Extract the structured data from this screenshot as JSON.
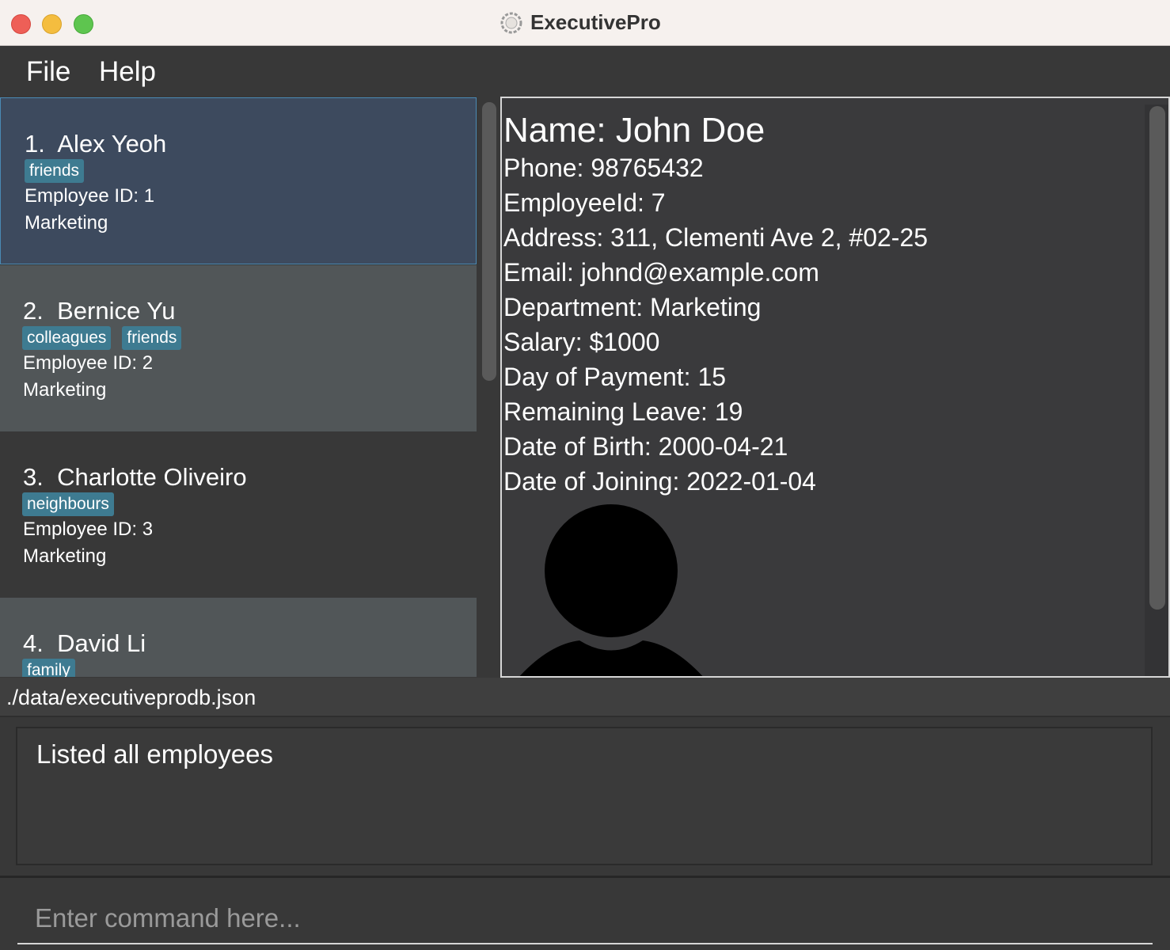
{
  "window": {
    "title": "ExecutivePro"
  },
  "menu": {
    "items": [
      {
        "label": "File"
      },
      {
        "label": "Help"
      }
    ]
  },
  "employees": [
    {
      "index": "1.",
      "name": "Alex Yeoh",
      "tags": [
        "friends"
      ],
      "employee_id": "Employee ID: 1",
      "department": "Marketing",
      "selected": true
    },
    {
      "index": "2.",
      "name": "Bernice Yu",
      "tags": [
        "colleagues",
        "friends"
      ],
      "employee_id": "Employee ID: 2",
      "department": "Marketing"
    },
    {
      "index": "3.",
      "name": "Charlotte Oliveiro",
      "tags": [
        "neighbours"
      ],
      "employee_id": "Employee ID: 3",
      "department": "Marketing"
    },
    {
      "index": "4.",
      "name": "David Li",
      "tags": [
        "family"
      ]
    }
  ],
  "detail": {
    "name": "Name: John Doe",
    "phone": "Phone: 98765432",
    "employee_id": "EmployeeId: 7",
    "address": "Address: 311, Clementi Ave 2, #02-25",
    "email": "Email: johnd@example.com",
    "department": "Department: Marketing",
    "salary": "Salary: $1000",
    "day_of_payment": "Day of Payment: 15",
    "remaining_leave": "Remaining Leave: 19",
    "date_of_birth": "Date of Birth: 2000-04-21",
    "date_of_joining": "Date of Joining: 2022-01-04",
    "avatar_icon": "person-silhouette-icon"
  },
  "status": {
    "file_path": "./data/executiveprodb.json"
  },
  "result": {
    "message": "Listed all employees"
  },
  "command": {
    "placeholder": "Enter command here...",
    "value": ""
  },
  "colors": {
    "tag": "#3e7b91",
    "selected_card": "#3d4a5e",
    "background": "#383838"
  }
}
